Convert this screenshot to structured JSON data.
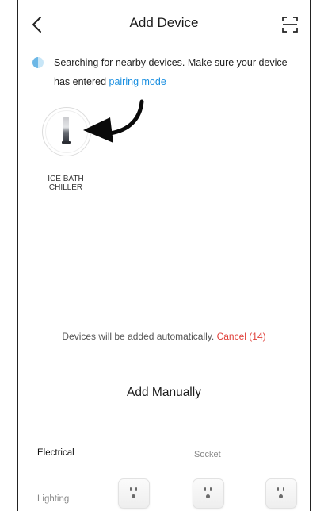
{
  "header": {
    "title": "Add Device"
  },
  "search": {
    "text": "Searching for nearby devices. Make sure your device has entered ",
    "link": "pairing mode"
  },
  "devices": [
    {
      "label": "ICE BATH\nCHILLER"
    }
  ],
  "auto": {
    "text": "Devices will be added automatically. ",
    "cancel": "Cancel (14)"
  },
  "manual": {
    "title": "Add Manually"
  },
  "categories": {
    "electrical": "Electrical",
    "lighting": "Lighting"
  },
  "subcategory": {
    "socket": "Socket"
  },
  "icons": {
    "back": "chevron-left-icon",
    "scan": "scan-icon",
    "spinner": "loading-spinner-icon",
    "arrow": "curved-arrow-icon",
    "socket": "socket-outlet-icon"
  },
  "colors": {
    "link": "#1a8fe0",
    "cancel": "#e0403a"
  }
}
